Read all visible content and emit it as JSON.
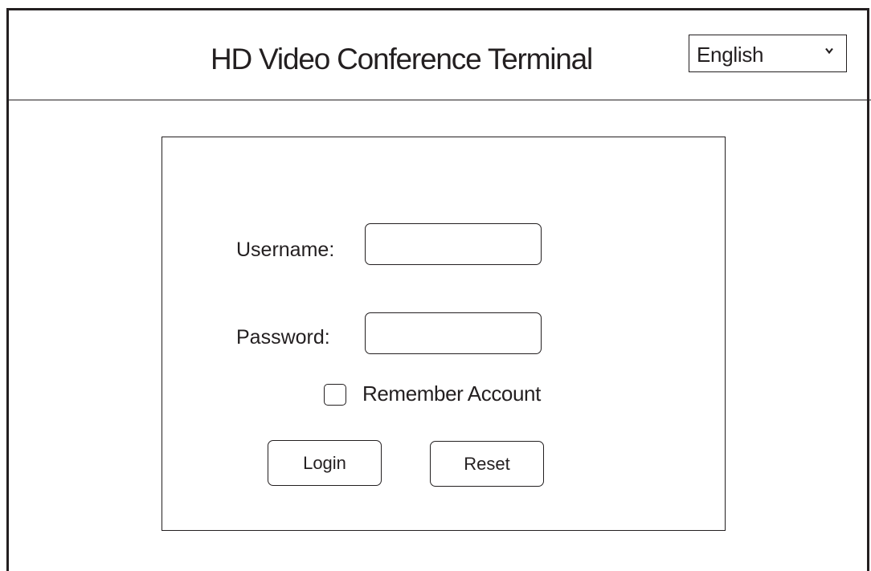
{
  "header": {
    "title": "HD Video Conference Terminal",
    "language": {
      "selected": "English",
      "icon": "chevron-down-icon"
    }
  },
  "login_form": {
    "username_label": "Username:",
    "username_value": "",
    "password_label": "Password:",
    "password_value": "",
    "remember_label": "Remember Account",
    "remember_checked": false,
    "login_button": "Login",
    "reset_button": "Reset"
  },
  "colors": {
    "line": "#231f20",
    "background": "#ffffff"
  }
}
